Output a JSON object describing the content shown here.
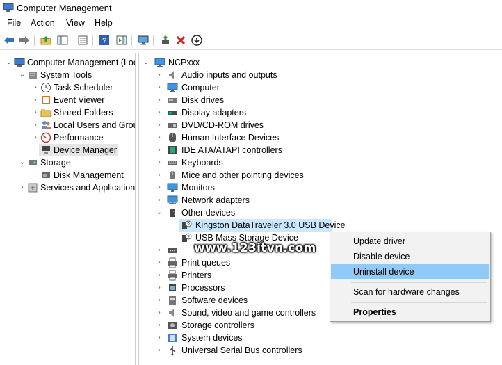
{
  "window": {
    "title": "Computer Management"
  },
  "menu": [
    "File",
    "Action",
    "View",
    "Help"
  ],
  "toolbar": {
    "icons": [
      "back-arrow-icon",
      "forward-arrow-icon",
      "up-folder-icon",
      "show-hide-tree-icon",
      "export-list-icon",
      "help-icon",
      "action-pane-icon",
      "monitor-icon",
      "update-driver-icon",
      "uninstall-x-icon",
      "download-icon"
    ]
  },
  "left_tree": [
    {
      "label": "Computer Management (Local",
      "icon": "computer-management-icon",
      "arrow": "down",
      "level": 0
    },
    {
      "label": "System Tools",
      "icon": "system-tools-icon",
      "arrow": "down",
      "level": 1
    },
    {
      "label": "Task Scheduler",
      "icon": "clock-icon",
      "arrow": "right",
      "level": 2
    },
    {
      "label": "Event Viewer",
      "icon": "event-viewer-icon",
      "arrow": "right",
      "level": 2
    },
    {
      "label": "Shared Folders",
      "icon": "shared-folder-icon",
      "arrow": "right",
      "level": 2
    },
    {
      "label": "Local Users and Groups",
      "icon": "users-icon",
      "arrow": "right",
      "level": 2
    },
    {
      "label": "Performance",
      "icon": "performance-icon",
      "arrow": "right",
      "level": 2
    },
    {
      "label": "Device Manager",
      "icon": "device-manager-icon",
      "arrow": "",
      "level": 2,
      "selected": true
    },
    {
      "label": "Storage",
      "icon": "storage-icon",
      "arrow": "down",
      "level": 1
    },
    {
      "label": "Disk Management",
      "icon": "disk-management-icon",
      "arrow": "",
      "level": 2
    },
    {
      "label": "Services and Applications",
      "icon": "services-icon",
      "arrow": "right",
      "level": 1
    }
  ],
  "device_tree": {
    "root": "NCPxxx",
    "items": [
      {
        "label": "Audio inputs and outputs",
        "icon": "speaker-icon",
        "arrow": "right"
      },
      {
        "label": "Computer",
        "icon": "computer-icon",
        "arrow": "right"
      },
      {
        "label": "Disk drives",
        "icon": "disk-drive-icon",
        "arrow": "right"
      },
      {
        "label": "Display adapters",
        "icon": "display-adapter-icon",
        "arrow": "right"
      },
      {
        "label": "DVD/CD-ROM drives",
        "icon": "dvd-icon",
        "arrow": "right"
      },
      {
        "label": "Human Interface Devices",
        "icon": "hid-icon",
        "arrow": "right"
      },
      {
        "label": "IDE ATA/ATAPI controllers",
        "icon": "ide-icon",
        "arrow": "right"
      },
      {
        "label": "Keyboards",
        "icon": "keyboard-icon",
        "arrow": "right"
      },
      {
        "label": "Mice and other pointing devices",
        "icon": "mouse-icon",
        "arrow": "right"
      },
      {
        "label": "Monitors",
        "icon": "monitor-icon",
        "arrow": "right"
      },
      {
        "label": "Network adapters",
        "icon": "network-icon",
        "arrow": "right"
      },
      {
        "label": "Other devices",
        "icon": "unknown-device-icon",
        "arrow": "down"
      },
      {
        "label": "Kingston DataTraveler 3.0 USB Device",
        "icon": "unknown-device-warning-icon",
        "arrow": "",
        "child": true,
        "selected": true
      },
      {
        "label": "USB Mass Storage Device",
        "icon": "unknown-device-warning-icon",
        "arrow": "",
        "child": true
      },
      {
        "label": "",
        "icon": "port-icon",
        "arrow": "right"
      },
      {
        "label": "Print queues",
        "icon": "printer-icon",
        "arrow": "right"
      },
      {
        "label": "Printers",
        "icon": "printer-icon",
        "arrow": "right"
      },
      {
        "label": "Processors",
        "icon": "processor-icon",
        "arrow": "right"
      },
      {
        "label": "Software devices",
        "icon": "software-device-icon",
        "arrow": "right"
      },
      {
        "label": "Sound, video and game controllers",
        "icon": "speaker-icon",
        "arrow": "right"
      },
      {
        "label": "Storage controllers",
        "icon": "storage-controller-icon",
        "arrow": "right"
      },
      {
        "label": "System devices",
        "icon": "system-device-icon",
        "arrow": "right"
      },
      {
        "label": "Universal Serial Bus controllers",
        "icon": "usb-icon",
        "arrow": "right"
      }
    ]
  },
  "context_menu": {
    "items": [
      {
        "label": "Update driver"
      },
      {
        "label": "Disable device"
      },
      {
        "label": "Uninstall device",
        "highlighted": true
      },
      {
        "label": "Scan for hardware changes"
      },
      {
        "label": "Properties",
        "bold": true
      }
    ]
  },
  "watermark": "www.123itvn.com"
}
